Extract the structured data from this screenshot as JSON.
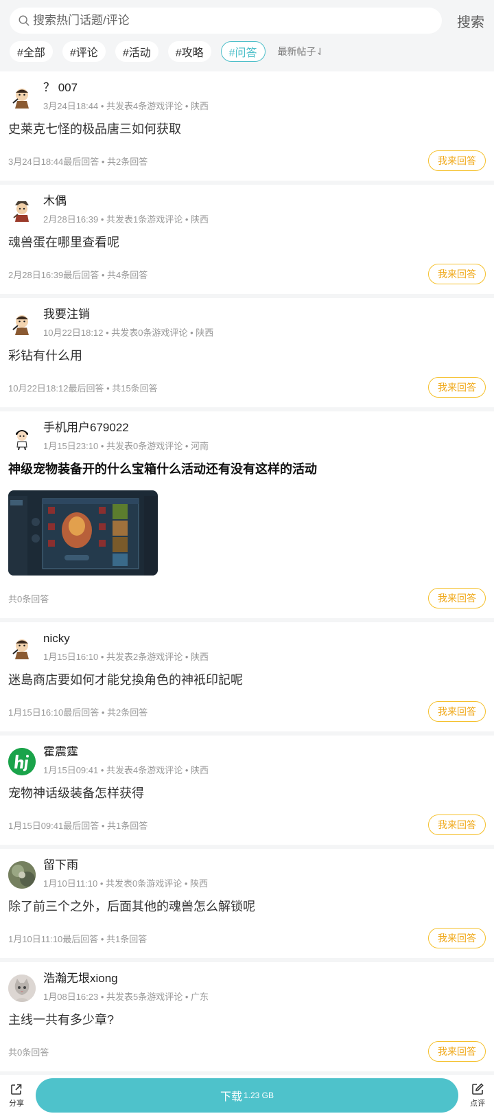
{
  "search": {
    "placeholder": "搜索热门话题/评论",
    "button_label": "搜索"
  },
  "tags": [
    {
      "label": "#全部",
      "active": false
    },
    {
      "label": "#评论",
      "active": false
    },
    {
      "label": "#活动",
      "active": false
    },
    {
      "label": "#攻略",
      "active": false
    },
    {
      "label": "#问答",
      "active": true
    }
  ],
  "sort_label": "最新帖子⇃",
  "posts": [
    {
      "username": "？ 007",
      "meta": "3月24日18:44 • 共发表4条游戏评论 • 陕西",
      "question": "史莱克七怪的极品唐三如何获取",
      "stats": "3月24日18:44最后回答 • 共2条回答",
      "answer_label": "我来回答"
    },
    {
      "username": "木偶",
      "meta": "2月28日16:39 • 共发表1条游戏评论 • 陕西",
      "question": "魂兽蛋在哪里查看呢",
      "stats": "2月28日16:39最后回答 • 共4条回答",
      "answer_label": "我来回答"
    },
    {
      "username": "我要注销",
      "meta": "10月22日18:12 • 共发表0条游戏评论 • 陕西",
      "question": "彩钻有什么用",
      "stats": "10月22日18:12最后回答 • 共15条回答",
      "answer_label": "我来回答"
    },
    {
      "username": "手机用户679022",
      "meta": "1月15日23:10 • 共发表0条游戏评论 • 河南",
      "question": "神级宠物装备开的什么宝箱什么活动还有没有这样的活动",
      "stats": "共0条回答",
      "answer_label": "我来回答"
    },
    {
      "username": "nicky",
      "meta": "1月15日16:10 • 共发表2条游戏评论 • 陕西",
      "question": "迷島商店要如何才能兌換角色的神衹印記呢",
      "stats": "1月15日16:10最后回答 • 共2条回答",
      "answer_label": "我来回答"
    },
    {
      "username": "霍震霆",
      "meta": "1月15日09:41 • 共发表4条游戏评论 • 陕西",
      "question": "宠物神话级装备怎样获得",
      "stats": "1月15日09:41最后回答 • 共1条回答",
      "answer_label": "我来回答"
    },
    {
      "username": "留下雨",
      "meta": "1月10日11:10 • 共发表0条游戏评论 • 陕西",
      "question": "除了前三个之外，后面其他的魂兽怎么解锁呢",
      "stats": "1月10日11:10最后回答 • 共1条回答",
      "answer_label": "我来回答"
    },
    {
      "username": "浩瀚无垠xiong",
      "meta": "1月08日16:23 • 共发表5条游戏评论 • 广东",
      "question": "主线一共有多少章?",
      "stats": "共0条回答",
      "answer_label": "我来回答"
    }
  ],
  "footer": {
    "share_label": "分享",
    "download_label": "下载",
    "download_size": "1.23 GB",
    "review_label": "点评"
  },
  "colors": {
    "accent": "#4ec2cb",
    "answer_border": "#f5c02b"
  }
}
